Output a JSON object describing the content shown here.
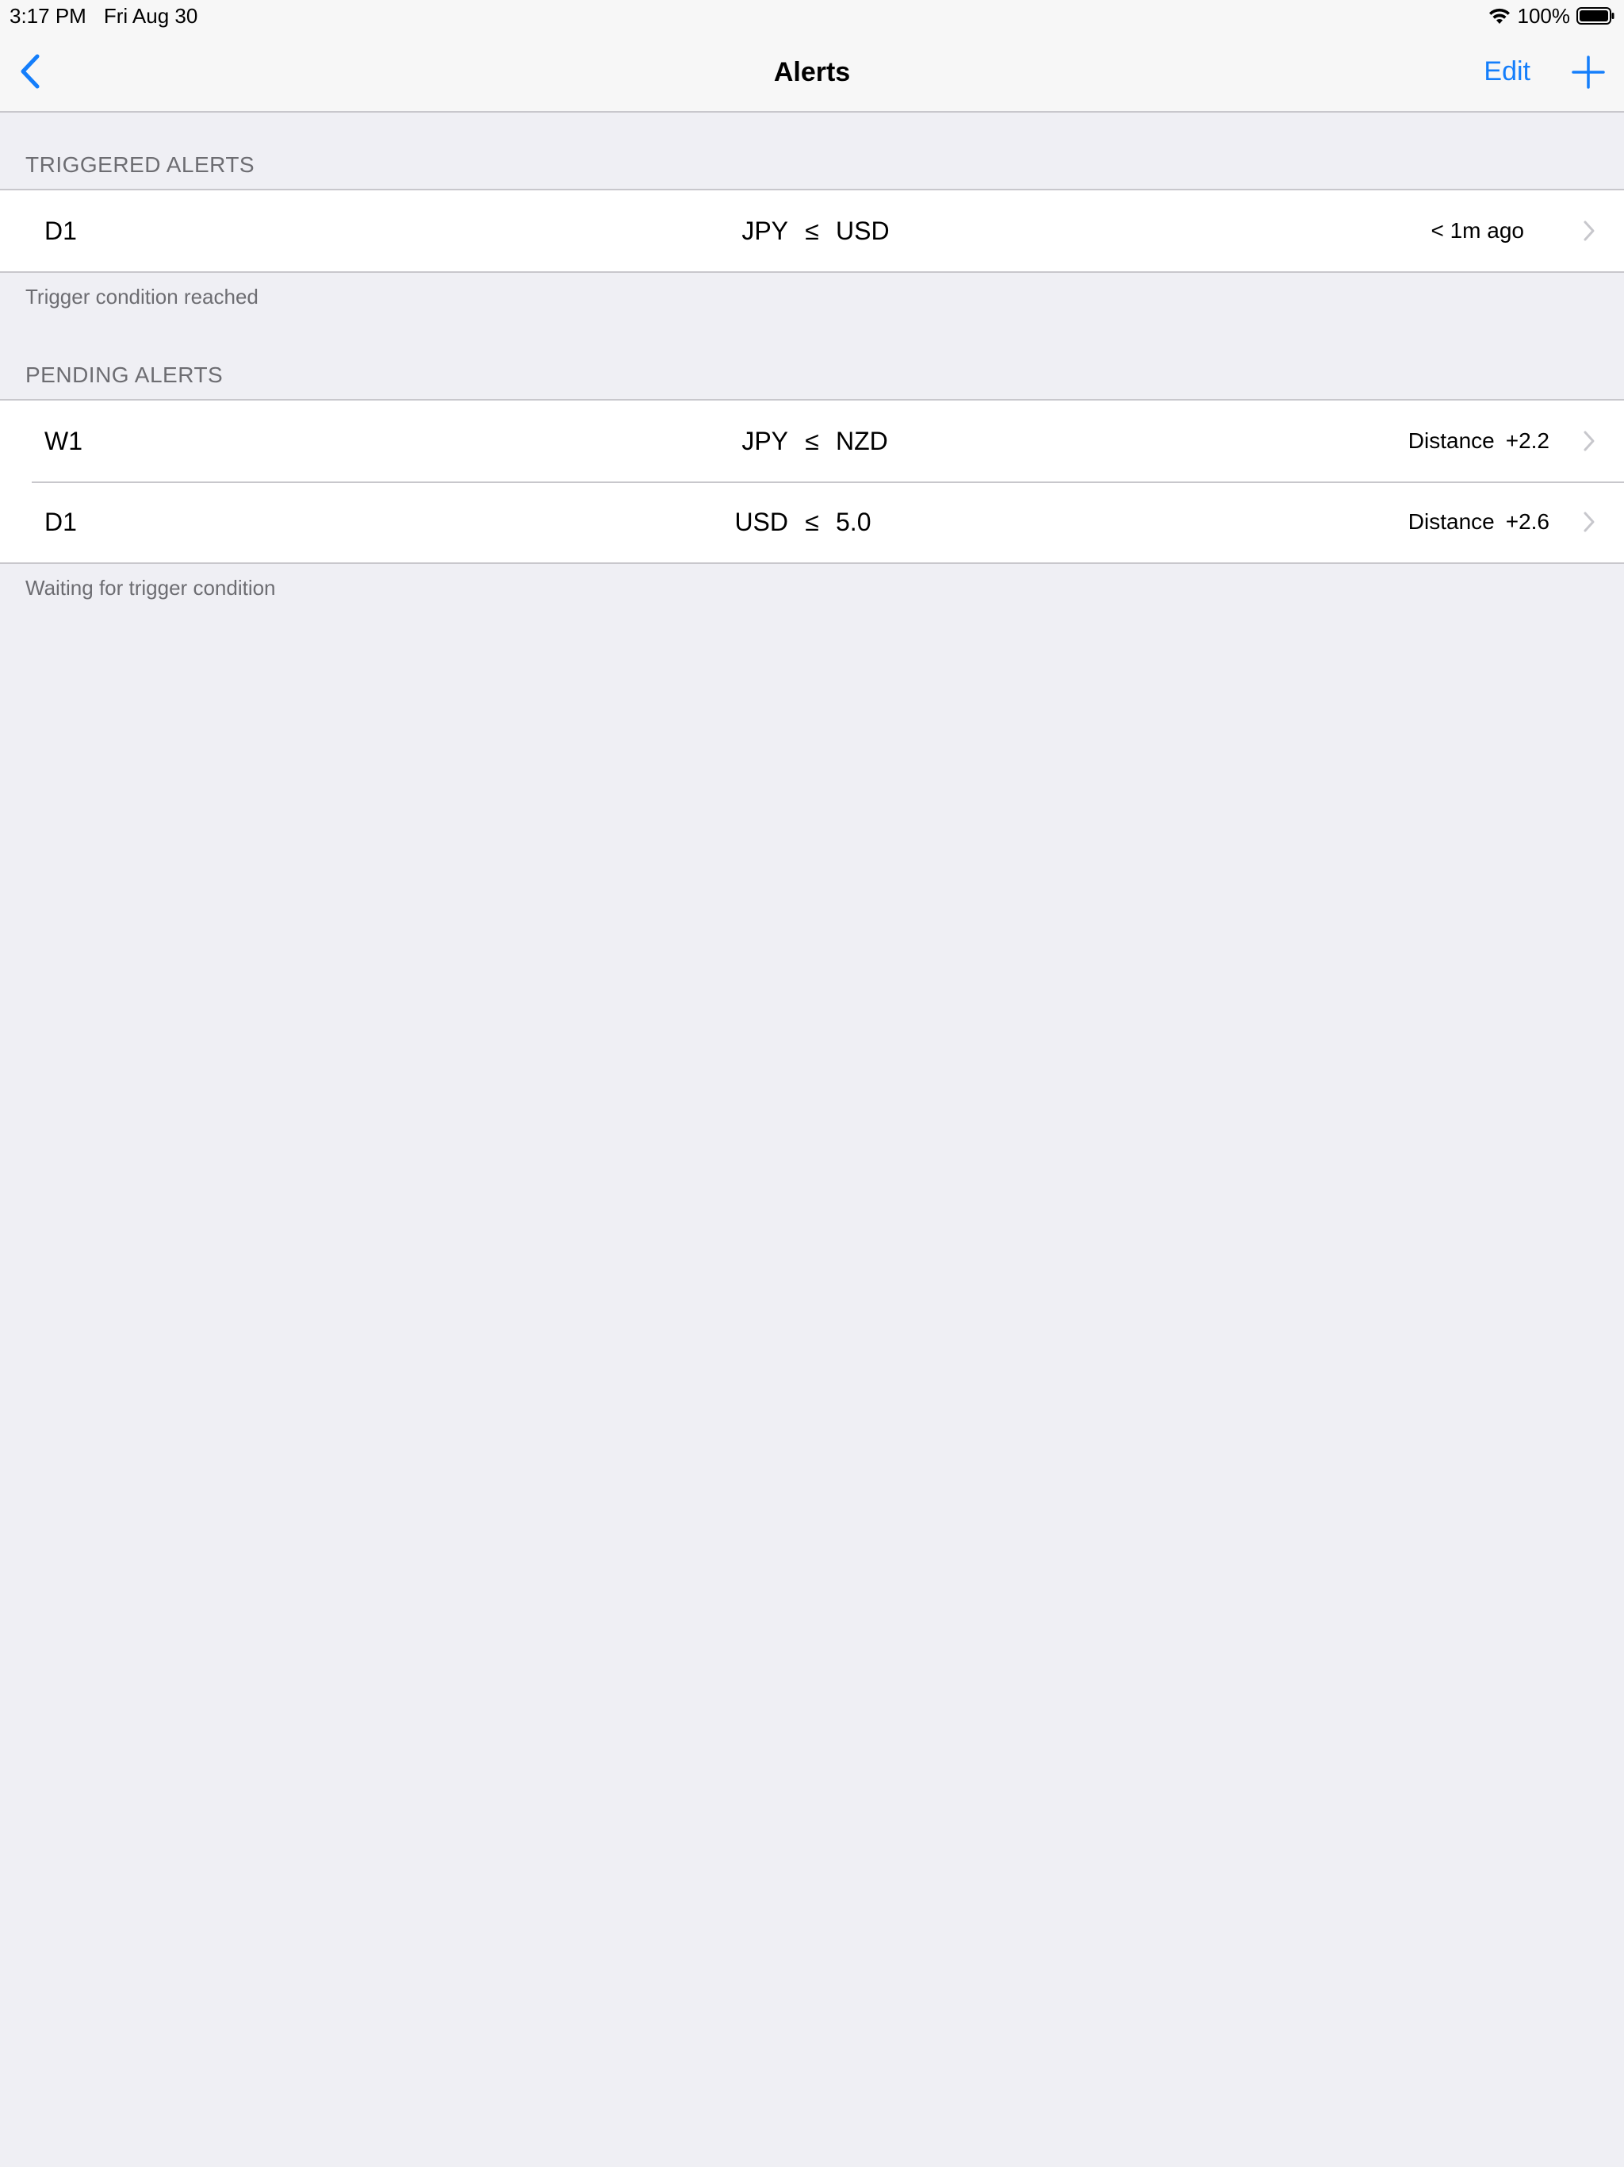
{
  "status_bar": {
    "time": "3:17 PM",
    "date": "Fri Aug 30",
    "battery": "100%",
    "icons": [
      "wifi-icon",
      "battery-icon"
    ]
  },
  "nav": {
    "back_icon": "chevron-left-icon",
    "title": "Alerts",
    "edit_label": "Edit",
    "add_icon": "plus-icon"
  },
  "colors": {
    "accent": "#147efb",
    "background": "#efeff4",
    "secondary_text": "#6d6d72"
  },
  "triggered": {
    "header": "TRIGGERED ALERTS",
    "footer": "Trigger condition reached",
    "rows": [
      {
        "timeframe": "D1",
        "left": "JPY",
        "operator": "≤",
        "right": "USD",
        "detail": "< 1m ago"
      }
    ]
  },
  "pending": {
    "header": "PENDING ALERTS",
    "footer": "Waiting for trigger condition",
    "rows": [
      {
        "timeframe": "W1",
        "left": "JPY",
        "operator": "≤",
        "right": "NZD",
        "distance_label": "Distance",
        "distance_value": "+2.2"
      },
      {
        "timeframe": "D1",
        "left": "USD",
        "operator": "≤",
        "right": "5.0",
        "distance_label": "Distance",
        "distance_value": "+2.6"
      }
    ]
  }
}
